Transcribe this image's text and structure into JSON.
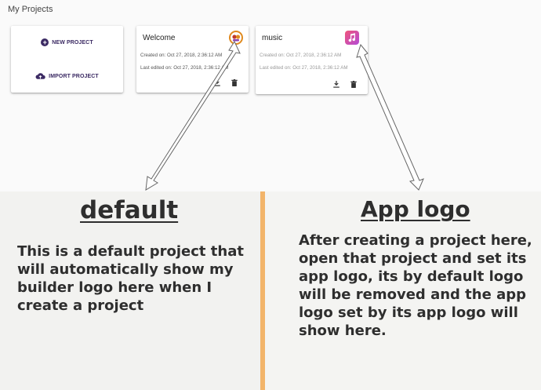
{
  "header": {
    "title": "My Projects"
  },
  "actions": {
    "new_project": "NEW PROJECT",
    "import_project": "IMPORT PROJECT"
  },
  "projects": [
    {
      "name": "Welcome",
      "created": "Created on: Oct 27, 2018, 2:36:12 AM",
      "edited": "Last edited on: Oct 27, 2018, 2:36:12 AM",
      "logo": "builder-default-logo-icon"
    },
    {
      "name": "music",
      "created": "Created on: Oct 27, 2018, 2:36:12 AM",
      "edited": "Last edited on: Oct 27, 2018, 2:36:12 AM",
      "logo": "music-app-logo-icon"
    }
  ],
  "annotations": {
    "default": {
      "heading": "default",
      "text": "This is a default project that will automatically show my builder logo here when I create a project"
    },
    "app_logo": {
      "heading": "App logo",
      "text": "After creating a project here, open that project and set its app logo, its by default logo will be removed and the app logo set by its app logo will show here."
    }
  },
  "colors": {
    "accent": "#3b2a63",
    "divider": "#f2b46a"
  }
}
